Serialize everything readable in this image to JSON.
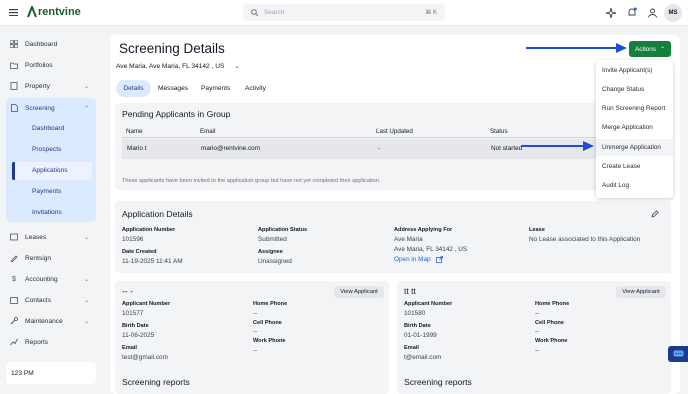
{
  "app": {
    "brand": "rentvine",
    "brand_color": "#1a5d2e",
    "accent": "#15803d"
  },
  "topbar": {
    "search_placeholder": "Search",
    "shortcut": "⌘ K",
    "avatar_initials": "MS"
  },
  "sidebar": {
    "items": [
      {
        "label": "Dashboard",
        "icon": "grid-icon"
      },
      {
        "label": "Portfolios",
        "icon": "folder-icon"
      },
      {
        "label": "Property",
        "icon": "building-icon"
      },
      {
        "label": "Screening",
        "icon": "document-icon"
      },
      {
        "label": "Leases",
        "icon": "lease-icon"
      },
      {
        "label": "Rentsign",
        "icon": "pen-icon"
      },
      {
        "label": "Accounting",
        "icon": "dollar-icon"
      },
      {
        "label": "Contacts",
        "icon": "contacts-icon"
      },
      {
        "label": "Maintenance",
        "icon": "wrench-icon"
      },
      {
        "label": "Reports",
        "icon": "chart-icon"
      }
    ],
    "screening_sub": [
      "Dashboard",
      "Prospects",
      "Applications",
      "Payments",
      "Invitations"
    ],
    "active_sub": "Applications",
    "footer_text": "123 PM"
  },
  "page": {
    "title": "Screening Details",
    "address_selector": "Ave Maria, Ave Maria, FL 34142 , US",
    "tabs": [
      "Details",
      "Messages",
      "Payments",
      "Activity"
    ],
    "active_tab": "Details",
    "actions_label": "Actions"
  },
  "actions_menu": [
    "Invite Applicant(s)",
    "Change Status",
    "Run Screening Report",
    "Merge Application",
    "Unmerge Application",
    "Create Lease",
    "Audit Log"
  ],
  "pending": {
    "title": "Pending Applicants in Group",
    "headers": [
      "Name",
      "Email",
      "Last Updated",
      "Status"
    ],
    "row": {
      "name": "Mario t",
      "email": "mario@rentvine.com",
      "updated": "-",
      "status": "Not started"
    },
    "note": "These applicants have been invited to the application group but have not yet completed their application."
  },
  "details": {
    "title": "Application Details",
    "application_number_label": "Application Number",
    "application_number": "101596",
    "date_created_label": "Date Created",
    "date_created": "11-19-2025 11:41 AM",
    "status_label": "Application Status",
    "status": "Submitted",
    "assignee_label": "Assignee",
    "assignee": "Unassigned",
    "address_label": "Address Applying For",
    "address_line1": "Ave Maria",
    "address_line2": "Ave Maria, FL 34142 , US",
    "open_map": "Open in Map",
    "lease_label": "Lease",
    "lease": "No Lease associated to this Application"
  },
  "applicants": [
    {
      "name": "-- -",
      "view": "View Applicant",
      "number_label": "Applicant Number",
      "number": "101577",
      "birth_label": "Birth Date",
      "birth": "11-06-2025",
      "email_label": "Email",
      "email": "test@gmail.com",
      "home_label": "Home Phone",
      "home": "--",
      "cell_label": "Cell Phone",
      "cell": "--",
      "work_label": "Work Phone",
      "work": "--",
      "reports": "Screening reports"
    },
    {
      "name": "tt tt",
      "view": "View Applicant",
      "number_label": "Applicant Number",
      "number": "101580",
      "birth_label": "Birth Date",
      "birth": "01-01-1999",
      "email_label": "Email",
      "email": "t@email.com",
      "home_label": "Home Phone",
      "home": "--",
      "cell_label": "Cell Phone",
      "cell": "--",
      "work_label": "Work Phone",
      "work": "--",
      "reports": "Screening reports"
    }
  ]
}
